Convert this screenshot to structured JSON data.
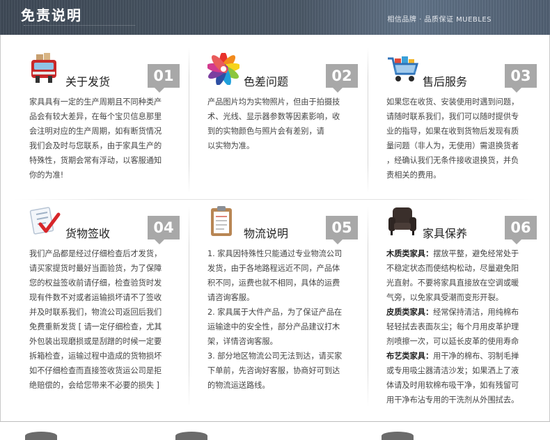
{
  "header": {
    "title": "免责说明",
    "slogan": "相信品牌 · 品质保证   MUEBLES"
  },
  "cards": [
    {
      "num": "01",
      "title": "关于发货",
      "icon": "delivery-truck-icon",
      "lines": [
        "家具具有一定的生产周期且不同种类产",
        "品会有较大差异，在每个宝贝信息那里",
        "会注明对应的生产周期，如有断货情况",
        "我们会及时与您联系，由于家具生产的",
        "特殊性，货期会常有浮动，以客服通知",
        "你的为准!"
      ]
    },
    {
      "num": "02",
      "title": "色差问题",
      "icon": "color-wheel-icon",
      "lines": [
        "产品图片均为实物照片，但由于拍摄技",
        "术、光线、显示器参数等因素影响，收",
        "到的实物颜色与照片会有差别，请",
        "以实物为准。"
      ]
    },
    {
      "num": "03",
      "title": "售后服务",
      "icon": "shopping-cart-icon",
      "lines": [
        "如果您在收货、安装使用时遇到问题，",
        "请随时联系我们，我们可以随时提供专",
        "业的指导，如果在收到货物后发现有质",
        "量问题（非人为，无使用）需退换货者",
        "，经确认我们无条件接收退换货，并负",
        "责相关的费用。"
      ]
    },
    {
      "num": "04",
      "title": "货物签收",
      "icon": "checklist-icon",
      "lines": [
        "我们产品都是经过仔细检查后才发货，",
        "请买家提货时最好当面验货，为了保障",
        "您的权益签收前请仔细，检查验货时发",
        "现有件数不对或者运输损坏请不了签收",
        "并及时联系我们，物流公司返回后我们",
        "免费重新发货 [ 请一定仔细检查，尤其",
        "外包装出现磨损或是刮蹭的时候一定要",
        "拆箱检查，运输过程中造成的货物损坏",
        "如不仔细检查而直接签收货运公司是拒",
        "绝赔偿的，会给您带来不必要的损失 ]"
      ]
    },
    {
      "num": "05",
      "title": "物流说明",
      "icon": "clipboard-icon",
      "lines": [
        "1. 家具因特殊性只能通过专业物流公司",
        "发货，由于各地路程远近不同，产品体",
        "积不同，运费也就不相同，具体的运费",
        "请咨询客服。",
        "2. 家具属于大件产品，为了保证产品在",
        "运输途中的安全性，部分产品建议打木",
        "架，详情咨询客服。",
        "3. 部分地区物流公司无法到达，请买家",
        "下单前，先咨询好客服，协商好可到达",
        "的物流运送路线。"
      ]
    },
    {
      "num": "06",
      "title": "家具保养",
      "icon": "armchair-icon",
      "sections": [
        {
          "label": "木质类家具：",
          "first": "摆放平整，避免经常处于",
          "rest": [
            "不稳定状态而使结构松动，尽量避免阳",
            "光直射。不要将家具直接放在空调或暖",
            "气旁，以免家具受潮而变形开裂。"
          ]
        },
        {
          "label": "皮质类家具：",
          "first": "经常保持清洁，用纯棉布",
          "rest": [
            "轻轻拭去表面灰尘；每个月用皮革护理",
            "剂喷擦一次，可以延长皮革的使用寿命"
          ]
        },
        {
          "label": "布艺类家具：",
          "first": "用干净的棉布、羽制毛掸",
          "rest": [
            "或专用吸尘器清洁沙发；如果洒上了液",
            "体请及时用软棉布吸干净，如有残留可",
            "用干净布沾专用的干洗剂从外围拭去。"
          ]
        }
      ]
    }
  ]
}
